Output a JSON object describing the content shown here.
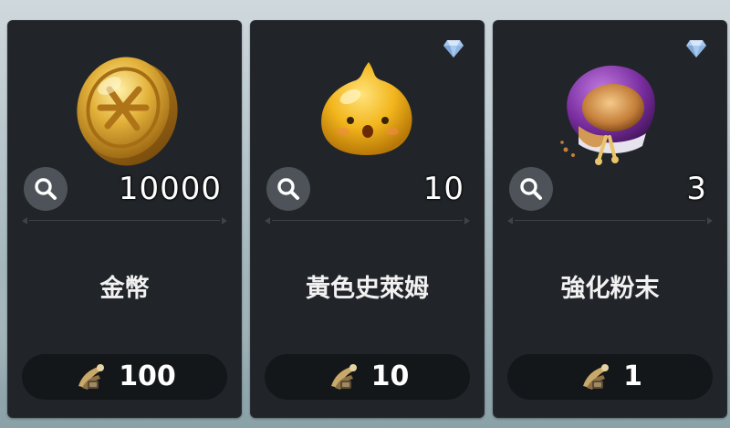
{
  "items": [
    {
      "name": "金幣",
      "quantity": "10000",
      "price": "100",
      "premium": false,
      "art": "gold-coin"
    },
    {
      "name": "黃色史萊姆",
      "quantity": "10",
      "price": "10",
      "premium": true,
      "art": "yellow-slime"
    },
    {
      "name": "強化粉末",
      "quantity": "3",
      "price": "1",
      "premium": true,
      "art": "enhancement-powder-bag"
    }
  ],
  "icons": {
    "zoom": "magnifier-icon",
    "premium": "diamond-icon",
    "currency": "horn-currency-icon"
  },
  "colors": {
    "card_bg": "#212529",
    "pill_bg": "#14171a",
    "zoom_bg": "#4d5359",
    "gem": "#a8c8ee"
  }
}
